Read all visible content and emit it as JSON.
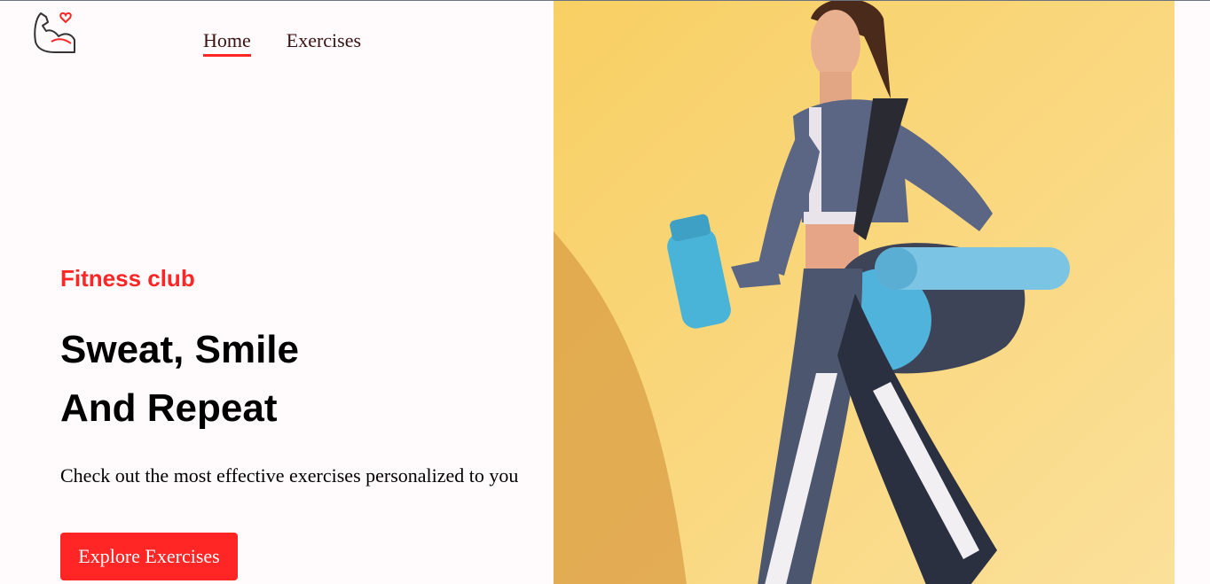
{
  "nav": {
    "logo_icon": "flexed-arm-heart-icon",
    "links": [
      {
        "label": "Home",
        "active": true
      },
      {
        "label": "Exercises",
        "active": false
      }
    ]
  },
  "hero": {
    "subtitle": "Fitness club",
    "headline_line1": "Sweat, Smile",
    "headline_line2": "And Repeat",
    "description": "Check out the most effective exercises personalized to you",
    "cta_label": "Explore Exercises",
    "banner_image": "woman-with-gym-bag-and-shaker-photo"
  },
  "colors": {
    "accent": "#ff2625",
    "background": "#fffafb",
    "banner_bg": "#f7c65e"
  }
}
